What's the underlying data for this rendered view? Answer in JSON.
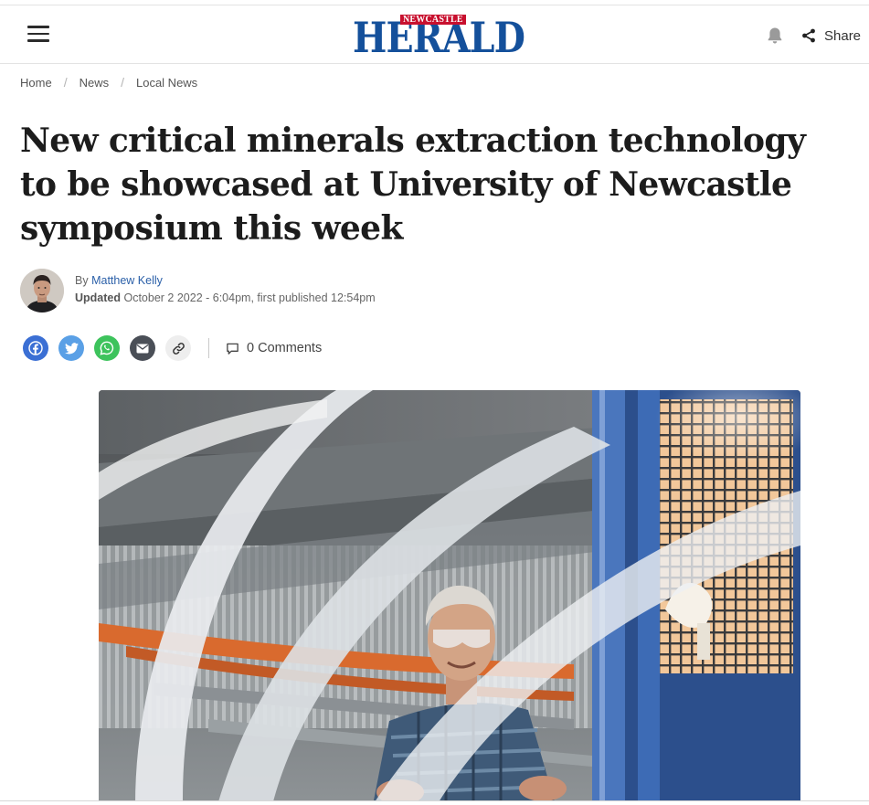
{
  "header": {
    "logo_kicker": "NEWCASTLE",
    "logo_name": "HERALD",
    "share_label": "Share",
    "brand_color": "#14509b",
    "kicker_color": "#c8102e"
  },
  "breadcrumb": {
    "items": [
      "Home",
      "News",
      "Local News"
    ],
    "separator": "/"
  },
  "article": {
    "headline": "New critical minerals extraction technology to be showcased at University of Newcastle symposium this week",
    "by_prefix": "By",
    "author": "Matthew Kelly",
    "updated_label": "Updated",
    "updated_text": "October 2 2022 - 6:04pm, first published 12:54pm"
  },
  "social": {
    "icons": [
      "facebook-icon",
      "twitter-icon",
      "whatsapp-icon",
      "email-icon",
      "link-icon"
    ],
    "comments_label": "0 Comments"
  }
}
